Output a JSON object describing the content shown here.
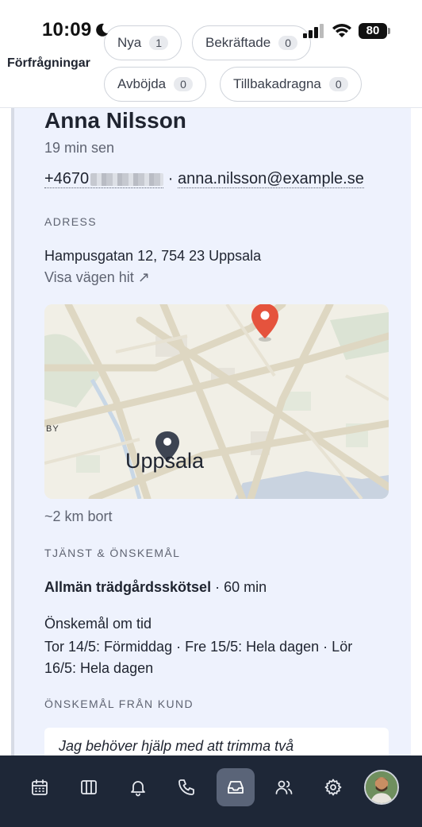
{
  "status_bar": {
    "time": "10:09",
    "battery": "80"
  },
  "header": {
    "title": "Förfrågningar",
    "filters": [
      {
        "label": "Nya",
        "count": "1"
      },
      {
        "label": "Bekräftade",
        "count": "0"
      },
      {
        "label": "Avböjda",
        "count": "0"
      },
      {
        "label": "Tillbakadragna",
        "count": "0"
      }
    ]
  },
  "request": {
    "name": "Anna Nilsson",
    "time_ago": "19 min sen",
    "phone_prefix": "+4670",
    "separator": " · ",
    "email": "anna.nilsson@example.se",
    "address_label": "ADRESS",
    "address": "Hampusgatan 12, 754 23 Uppsala",
    "directions_link": "Visa vägen hit ↗",
    "map": {
      "city_label": "Uppsala",
      "district_label": "BY"
    },
    "distance": "~2 km bort",
    "service_label": "TJÄNST & ÖNSKEMÅL",
    "service_name": "Allmän trädgårdsskötsel",
    "service_duration": " · 60 min",
    "time_wish_label": "Önskemål om tid",
    "time_wish_value": "Tor 14/5: Förmiddag · Fre 15/5: Hela dagen · Lör 16/5: Hela dagen",
    "customer_wish_label": "ÖNSKEMÅL FRÅN KUND",
    "customer_wish_text": "Jag behöver hjälp med att trimma två"
  },
  "tabbar": {
    "items": [
      "calendar-icon",
      "columns-icon",
      "bell-icon",
      "phone-icon",
      "inbox-icon",
      "users-icon",
      "gear-icon"
    ],
    "active": "inbox-icon"
  },
  "colors": {
    "panel": "#eef2fd",
    "tabbar": "#1e2737",
    "pin_red": "#e5533d",
    "pin_dark": "#3d4452"
  }
}
